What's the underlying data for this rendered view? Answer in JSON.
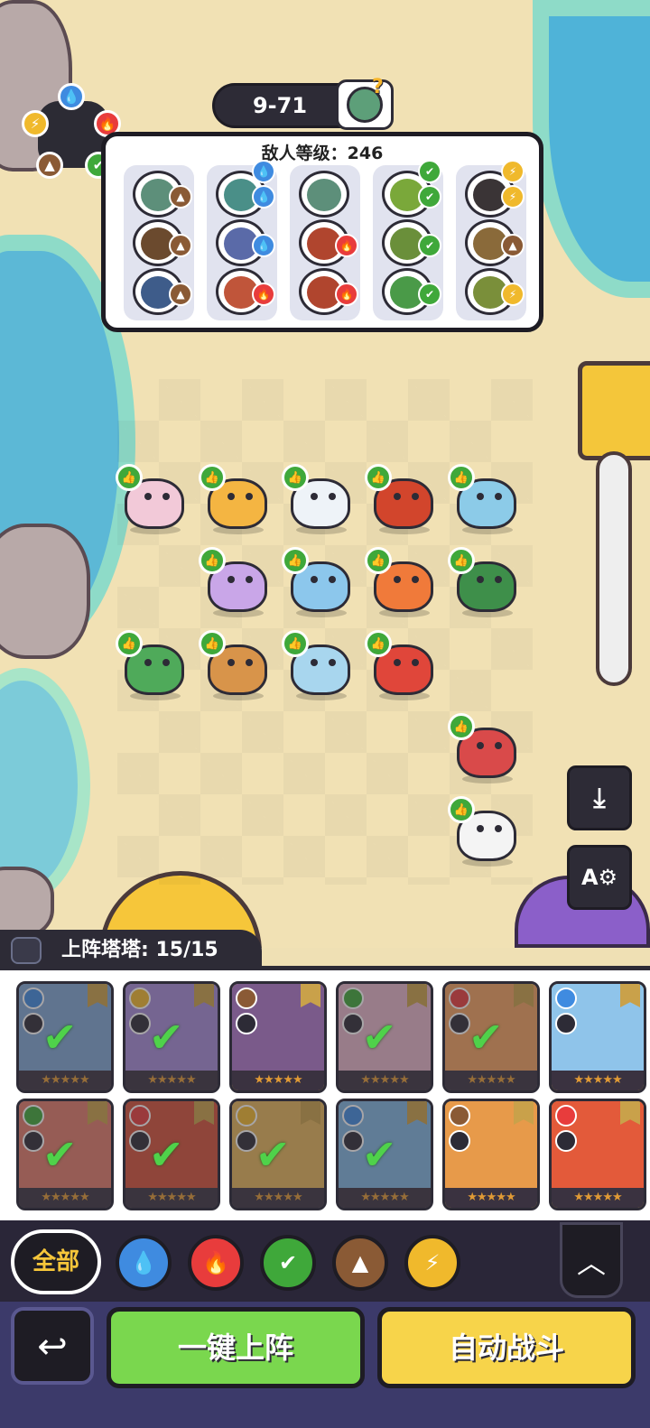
{
  "stage": {
    "label": "9-71",
    "help_mark": "?"
  },
  "enemy": {
    "level_text": "敌人等级：246",
    "waves": [
      {
        "foes": [
          {
            "color": "#5d8f7a",
            "element": "earth"
          },
          {
            "color": "#6b4a2e",
            "element": "earth"
          },
          {
            "color": "#3e5c8a",
            "element": "earth"
          }
        ],
        "wave_badge": "none"
      },
      {
        "foes": [
          {
            "color": "#4a8f88",
            "element": "water"
          },
          {
            "color": "#5a6aa8",
            "element": "water"
          },
          {
            "color": "#c0553a",
            "element": "fire"
          }
        ],
        "wave_badge": "water"
      },
      {
        "foes": [
          {
            "color": "#5d8f7a",
            "element": "none"
          },
          {
            "color": "#b0452e",
            "element": "fire"
          },
          {
            "color": "#b0452e",
            "element": "fire"
          }
        ],
        "wave_badge": "none"
      },
      {
        "foes": [
          {
            "color": "#7aa83a",
            "element": "leaf"
          },
          {
            "color": "#6a8f3a",
            "element": "leaf"
          },
          {
            "color": "#4a9a48",
            "element": "leaf"
          }
        ],
        "wave_badge": "leaf"
      },
      {
        "foes": [
          {
            "color": "#3a3436",
            "element": "bolt"
          },
          {
            "color": "#8a6a3a",
            "element": "earth"
          },
          {
            "color": "#7a8f3a",
            "element": "bolt"
          }
        ],
        "wave_badge": "bolt"
      }
    ]
  },
  "element_wheel": [
    "water",
    "fire",
    "leaf",
    "earth",
    "bolt"
  ],
  "side_buttons": [
    {
      "name": "save-lineup-button",
      "icon": "download-icon",
      "glyph": "⤓"
    },
    {
      "name": "auto-settings-button",
      "icon": "auto-gear-icon",
      "glyph": "A⚙"
    }
  ],
  "roster": {
    "label": "上阵塔塔: 15/15",
    "cards": [
      {
        "element": "water",
        "color": "#7fa6d4",
        "deployed": true,
        "stars": "★★★★★"
      },
      {
        "element": "bolt",
        "color": "#a58bd8",
        "deployed": true,
        "stars": "★★★★★"
      },
      {
        "element": "earth",
        "color": "#7a5a8a",
        "deployed": false,
        "stars": "★★★★★"
      },
      {
        "element": "leaf",
        "color": "#e3b5c9",
        "deployed": true,
        "stars": "★★★★★"
      },
      {
        "element": "fire",
        "color": "#f0a060",
        "deployed": true,
        "stars": "★★★★★"
      },
      {
        "element": "water",
        "color": "#8fc4ea",
        "deployed": false,
        "stars": "★★★★★"
      },
      {
        "element": "leaf",
        "color": "#e07a6a",
        "deployed": true,
        "stars": "★★★★★"
      },
      {
        "element": "fire",
        "color": "#d4503a",
        "deployed": true,
        "stars": "★★★★★"
      },
      {
        "element": "bolt",
        "color": "#e3b55a",
        "deployed": true,
        "stars": "★★★★★"
      },
      {
        "element": "water",
        "color": "#7fb4e0",
        "deployed": true,
        "stars": "★★★★★"
      },
      {
        "element": "earth",
        "color": "#e79a4a",
        "deployed": false,
        "stars": "★★★★★"
      },
      {
        "element": "fire",
        "color": "#e35a3a",
        "deployed": false,
        "stars": "★★★★★"
      }
    ]
  },
  "filters": {
    "all_label": "全部",
    "elements": [
      "water",
      "fire",
      "leaf",
      "earth",
      "bolt"
    ]
  },
  "actions": {
    "deploy_label": "一键上阵",
    "auto_battle_label": "自动战斗",
    "back_icon": "↩",
    "collapse_icon": "︿"
  },
  "colors": {
    "water": "#3f8be0",
    "fire": "#e83c3c",
    "leaf": "#3fa83a",
    "earth": "#8a5a35",
    "bolt": "#f0b92c",
    "accent_yellow": "#f7d44a",
    "accent_green": "#7ad74e"
  },
  "board_towers": [
    {
      "color": "#f2c9d8",
      "row": 0,
      "col": 0
    },
    {
      "color": "#f4b542",
      "row": 0,
      "col": 1
    },
    {
      "color": "#eef3f8",
      "row": 0,
      "col": 2
    },
    {
      "color": "#d2452c",
      "row": 0,
      "col": 3
    },
    {
      "color": "#8ccbe8",
      "row": 0,
      "col": 4
    },
    {
      "color": "#c9a6e8",
      "row": 1,
      "col": 1
    },
    {
      "color": "#8cc7ec",
      "row": 1,
      "col": 2
    },
    {
      "color": "#f07a3a",
      "row": 1,
      "col": 3
    },
    {
      "color": "#3e8f4a",
      "row": 1,
      "col": 4
    },
    {
      "color": "#4faa5a",
      "row": 2,
      "col": 0
    },
    {
      "color": "#d8944a",
      "row": 2,
      "col": 1
    },
    {
      "color": "#a8d6ee",
      "row": 2,
      "col": 2
    },
    {
      "color": "#e0463a",
      "row": 2,
      "col": 3
    },
    {
      "color": "#d94a4a",
      "row": 3,
      "col": 4
    },
    {
      "color": "#f4f4f4",
      "row": 4,
      "col": 4
    }
  ]
}
